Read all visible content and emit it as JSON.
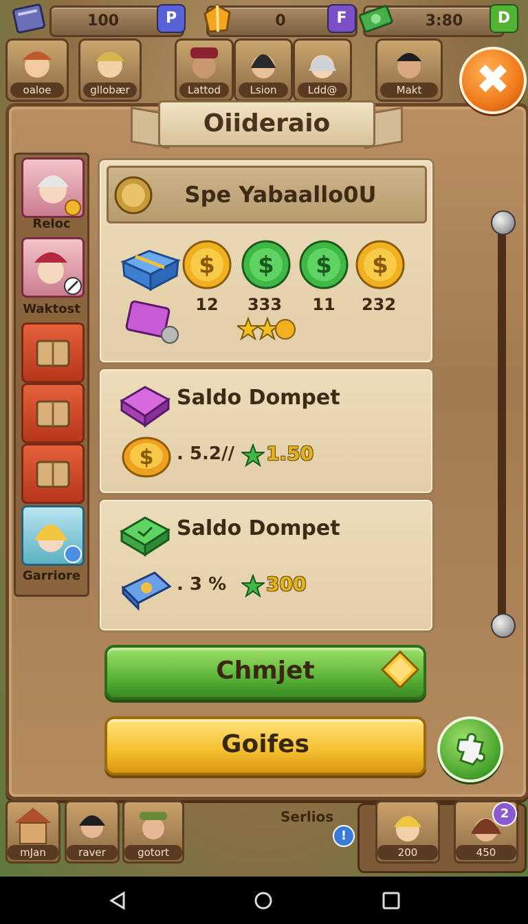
{
  "top_bar": {
    "resource1": {
      "value": "100",
      "badge": "P",
      "badge_color": "#5a63d6"
    },
    "resource2": {
      "value": "0",
      "badge": "F",
      "badge_color": "#7b4fc7"
    },
    "resource3": {
      "value": "3:80",
      "badge": "D",
      "badge_color": "#54b234"
    }
  },
  "characters": [
    {
      "label": "oaloe"
    },
    {
      "label": "gllobær"
    },
    {
      "label": "Lattod"
    },
    {
      "label": "Lsion"
    },
    {
      "label": "Ldd@"
    },
    {
      "label": "Makt"
    }
  ],
  "panel": {
    "title": "Oiideraio"
  },
  "side_list": [
    {
      "label": "Reloc",
      "kind": "portrait"
    },
    {
      "label": "Waktost",
      "kind": "portrait"
    },
    {
      "label": "",
      "kind": "chest"
    },
    {
      "label": "",
      "kind": "chest"
    },
    {
      "label": "",
      "kind": "chest"
    },
    {
      "label": "Garriore",
      "kind": "portrait-blue"
    }
  ],
  "rewards_card": {
    "header": "Spe Yabaallo0U",
    "coins": [
      {
        "value": "12",
        "color": "gold"
      },
      {
        "value": "333",
        "color": "green"
      },
      {
        "value": "11",
        "color": "green"
      },
      {
        "value": "232",
        "color": "gold"
      }
    ]
  },
  "wallet1": {
    "title": "Saldo Dompet",
    "amount": ". 5.2∕∕",
    "stars": "1.50"
  },
  "wallet2": {
    "title": "Saldo Dompet",
    "amount": ". 3 %",
    "stars": "300"
  },
  "buttons": {
    "green": "Chmjet",
    "yellow": "Goifes"
  },
  "bottom_bar": {
    "items": [
      {
        "label": "mJan"
      },
      {
        "label": "raver"
      },
      {
        "label": "gotort"
      }
    ],
    "center_label": "Serlios",
    "right_items": [
      {
        "value": "200"
      },
      {
        "value": "450",
        "badge": "2"
      }
    ]
  },
  "icons": [
    "close-icon",
    "coin-icon",
    "star-icon",
    "gem-icon",
    "chest-icon",
    "gift-icon",
    "ticket-icon"
  ],
  "colors": {
    "accent_orange": "#f07a1a",
    "accent_green": "#5cb438",
    "accent_yellow": "#f4bf2e"
  }
}
